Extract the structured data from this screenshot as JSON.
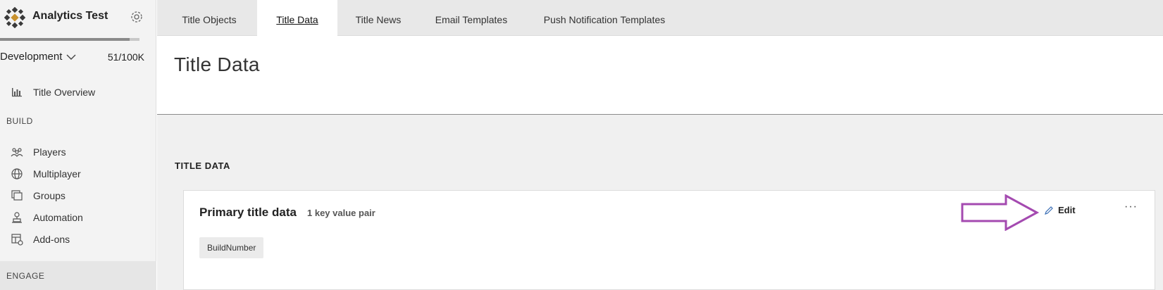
{
  "app": {
    "title": "Analytics Test"
  },
  "environment": {
    "name": "Development",
    "usage": "51/100K",
    "usage_fraction": 0.93
  },
  "sidebar": {
    "overview": {
      "label": "Title Overview",
      "icon": "bar-chart-icon"
    },
    "build_heading": "BUILD",
    "build_items": [
      {
        "label": "Players",
        "icon": "players-icon"
      },
      {
        "label": "Multiplayer",
        "icon": "globe-icon"
      },
      {
        "label": "Groups",
        "icon": "groups-icon"
      },
      {
        "label": "Automation",
        "icon": "robot-icon"
      },
      {
        "label": "Add-ons",
        "icon": "addons-icon"
      }
    ],
    "engage_heading": "ENGAGE"
  },
  "tabs": [
    {
      "label": "Title Objects",
      "active": false
    },
    {
      "label": "Title Data",
      "active": true
    },
    {
      "label": "Title News",
      "active": false
    },
    {
      "label": "Email Templates",
      "active": false
    },
    {
      "label": "Push Notification Templates",
      "active": false
    }
  ],
  "main": {
    "page_title": "Title Data",
    "section_label": "TITLE DATA",
    "card": {
      "title": "Primary title data",
      "count": "1 key value pair",
      "edit_label": "Edit",
      "more_label": "···",
      "keys": [
        "BuildNumber"
      ]
    }
  },
  "colors": {
    "accent": "#a44ab0",
    "sidebar_bg": "#f3f3f3",
    "tabbar_bg": "#e8e8e8"
  }
}
